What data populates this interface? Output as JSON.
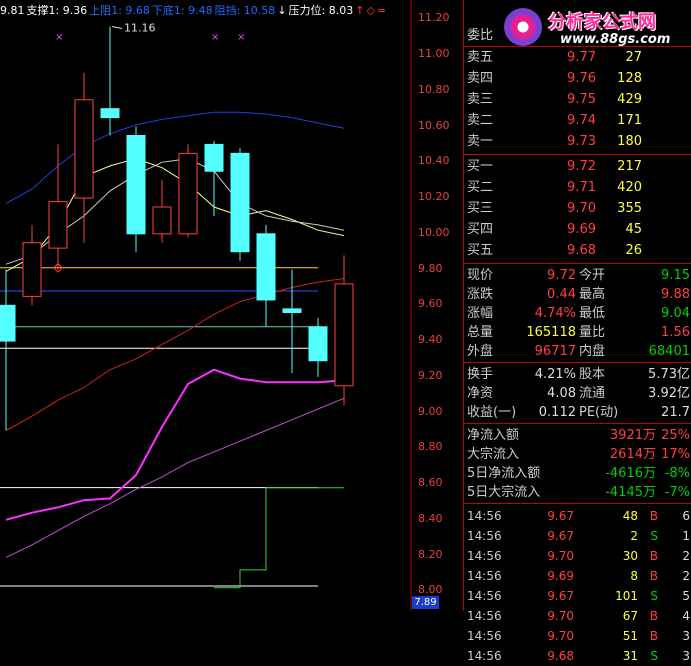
{
  "topbar": [
    {
      "text": "9.81",
      "color": "#ffffff"
    },
    {
      "text": "支撑1: 9.36",
      "color": "#ffffff"
    },
    {
      "text": "上阻1: 9.68",
      "color": "#1e6cff"
    },
    {
      "text": "下底1: 9.48",
      "color": "#1e6cff"
    },
    {
      "text": "阻挡: 10.58",
      "color": "#1e6cff"
    },
    {
      "text": "↓",
      "color": "#ffffff"
    },
    {
      "text": "压力位: 8.03",
      "color": "#ffffff"
    },
    {
      "text": "↑",
      "color": "#ff3030"
    },
    {
      "text": "◇",
      "color": "#ff3030"
    },
    {
      "text": "=",
      "color": "#ff3030"
    }
  ],
  "annotation_high": "11.16",
  "price_axis": [
    "11.20",
    "11.00",
    "10.80",
    "10.60",
    "10.40",
    "10.20",
    "10.00",
    "9.80",
    "9.60",
    "9.40",
    "9.20",
    "9.00",
    "8.80",
    "8.60",
    "8.40",
    "8.20",
    "8.00"
  ],
  "price_axis_bottom": "7.89",
  "logo": {
    "title": "分析家公式网",
    "url": "www.88gs.com"
  },
  "order_book": {
    "header": "委比",
    "asks": [
      {
        "label": "卖五",
        "price": "9.77",
        "vol": "27"
      },
      {
        "label": "卖四",
        "price": "9.76",
        "vol": "128"
      },
      {
        "label": "卖三",
        "price": "9.75",
        "vol": "429"
      },
      {
        "label": "卖二",
        "price": "9.74",
        "vol": "171"
      },
      {
        "label": "卖一",
        "price": "9.73",
        "vol": "180"
      }
    ],
    "bids": [
      {
        "label": "买一",
        "price": "9.72",
        "vol": "217"
      },
      {
        "label": "买二",
        "price": "9.71",
        "vol": "420"
      },
      {
        "label": "买三",
        "price": "9.70",
        "vol": "355"
      },
      {
        "label": "买四",
        "price": "9.69",
        "vol": "45"
      },
      {
        "label": "买五",
        "price": "9.68",
        "vol": "26"
      }
    ]
  },
  "quote": [
    {
      "l1": "现价",
      "v1": "9.72",
      "c1": "red",
      "l2": "今开",
      "v2": "9.15",
      "c2": "green"
    },
    {
      "l1": "涨跌",
      "v1": "0.44",
      "c1": "red",
      "l2": "最高",
      "v2": "9.88",
      "c2": "red"
    },
    {
      "l1": "涨幅",
      "v1": "4.74%",
      "c1": "red",
      "l2": "最低",
      "v2": "9.04",
      "c2": "green"
    },
    {
      "l1": "总量",
      "v1": "165118",
      "c1": "yel",
      "l2": "量比",
      "v2": "1.56",
      "c2": "red"
    },
    {
      "l1": "外盘",
      "v1": "96717",
      "c1": "red",
      "l2": "内盘",
      "v2": "68401",
      "c2": "green"
    }
  ],
  "fundamentals": [
    {
      "l1": "换手",
      "v1": "4.21%",
      "l2": "股本",
      "v2": "5.73亿"
    },
    {
      "l1": "净资",
      "v1": "4.08",
      "l2": "流通",
      "v2": "3.92亿"
    },
    {
      "l1": "收益(一)",
      "v1": "0.112",
      "l2": "PE(动)",
      "v2": "21.7"
    }
  ],
  "flows": [
    {
      "label": "净流入额",
      "value": "3921万",
      "pct": "25%",
      "color": "red"
    },
    {
      "label": "大宗流入",
      "value": "2614万",
      "pct": "17%",
      "color": "red"
    },
    {
      "label": "5日净流入额",
      "value": "-4616万",
      "pct": "-8%",
      "color": "green"
    },
    {
      "label": "5日大宗流入",
      "value": "-4145万",
      "pct": "-7%",
      "color": "green"
    }
  ],
  "trades": [
    {
      "time": "14:56",
      "price": "9.67",
      "vol": "48",
      "side": "B",
      "extra": "6"
    },
    {
      "time": "14:56",
      "price": "9.67",
      "vol": "2",
      "side": "S",
      "extra": "1"
    },
    {
      "time": "14:56",
      "price": "9.70",
      "vol": "30",
      "side": "B",
      "extra": "2"
    },
    {
      "time": "14:56",
      "price": "9.69",
      "vol": "8",
      "side": "B",
      "extra": "2"
    },
    {
      "time": "14:56",
      "price": "9.67",
      "vol": "101",
      "side": "S",
      "extra": "5"
    },
    {
      "time": "14:56",
      "price": "9.70",
      "vol": "67",
      "side": "B",
      "extra": "4"
    },
    {
      "time": "14:56",
      "price": "9.70",
      "vol": "51",
      "side": "B",
      "extra": "3"
    },
    {
      "time": "14:56",
      "price": "9.68",
      "vol": "31",
      "side": "S",
      "extra": "3"
    }
  ],
  "chart_data": {
    "type": "candlestick",
    "ylim": [
      7.89,
      11.28
    ],
    "candles": [
      {
        "o": 9.6,
        "c": 9.4,
        "h": 9.8,
        "l": 8.9
      },
      {
        "o": 9.65,
        "c": 9.95,
        "h": 10.05,
        "l": 9.6
      },
      {
        "o": 9.92,
        "c": 10.18,
        "h": 10.5,
        "l": 9.8
      },
      {
        "o": 10.2,
        "c": 10.75,
        "h": 10.9,
        "l": 9.95
      },
      {
        "o": 10.7,
        "c": 10.65,
        "h": 11.16,
        "l": 10.55
      },
      {
        "o": 10.55,
        "c": 10.0,
        "h": 10.6,
        "l": 9.9
      },
      {
        "o": 10.0,
        "c": 10.15,
        "h": 10.3,
        "l": 9.95
      },
      {
        "o": 10.0,
        "c": 10.45,
        "h": 10.5,
        "l": 9.98
      },
      {
        "o": 10.5,
        "c": 10.35,
        "h": 10.52,
        "l": 10.1
      },
      {
        "o": 10.45,
        "c": 9.9,
        "h": 10.48,
        "l": 9.85
      },
      {
        "o": 10.0,
        "c": 9.63,
        "h": 10.05,
        "l": 9.48
      },
      {
        "o": 9.58,
        "c": 9.56,
        "h": 9.8,
        "l": 9.22
      },
      {
        "o": 9.48,
        "c": 9.29,
        "h": 9.53,
        "l": 9.2
      },
      {
        "o": 9.15,
        "c": 9.72,
        "h": 9.88,
        "l": 9.04
      }
    ],
    "hlines": [
      {
        "value": 9.81,
        "color": "#ffd24a"
      },
      {
        "value": 9.68,
        "color": "#3050ff"
      },
      {
        "value": 9.48,
        "color": "#4ad6c0"
      },
      {
        "value": 9.36,
        "color": "#ffffff"
      },
      {
        "value": 8.58,
        "color": "#ffffff"
      },
      {
        "value": 8.03,
        "color": "#ffffff"
      }
    ],
    "ma_blue": [
      10.17,
      10.25,
      10.38,
      10.49,
      10.56,
      10.61,
      10.64,
      10.66,
      10.68,
      10.68,
      10.67,
      10.65,
      10.62,
      10.59
    ],
    "ma_yellow": [
      9.79,
      9.87,
      10.05,
      10.32,
      10.38,
      10.42,
      10.37,
      10.28,
      10.15,
      10.1,
      10.13,
      10.08,
      10.02,
      9.99
    ],
    "ma_white": [
      9.83,
      9.88,
      10.0,
      10.1,
      10.24,
      10.33,
      10.4,
      10.42,
      10.35,
      10.17,
      10.1,
      10.07,
      10.05,
      10.02
    ],
    "ma_red": [
      8.9,
      8.98,
      9.07,
      9.14,
      9.24,
      9.3,
      9.38,
      9.46,
      9.55,
      9.62,
      9.66,
      9.7,
      9.73,
      9.75
    ],
    "ma_magenta": [
      8.4,
      8.44,
      8.47,
      8.51,
      8.52,
      8.65,
      8.92,
      9.16,
      9.24,
      9.19,
      9.17,
      9.17,
      9.17,
      9.18
    ],
    "ma_violet": [
      8.19,
      8.26,
      8.34,
      8.42,
      8.49,
      8.57,
      8.64,
      8.72,
      8.78,
      8.84,
      8.9,
      8.96,
      9.02,
      9.08
    ],
    "green_step": [
      null,
      null,
      null,
      null,
      null,
      null,
      null,
      null,
      8.02,
      8.12,
      8.58,
      8.58,
      8.58,
      8.58
    ]
  }
}
